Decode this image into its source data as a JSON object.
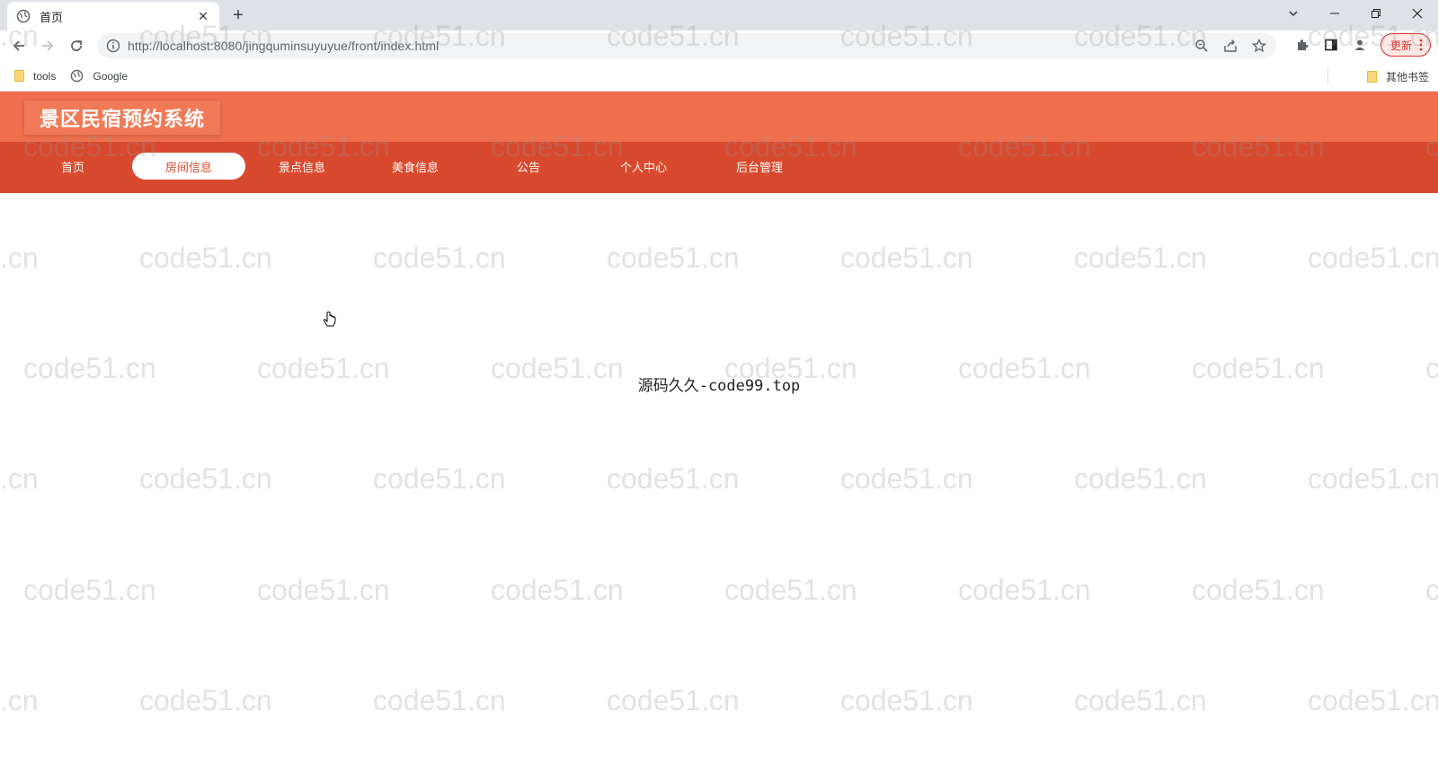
{
  "browser": {
    "tab_title": "首页",
    "url": "http://localhost:8080/jingquminsuyuyue/front/index.html",
    "update_label": "更新",
    "bookmarks": [
      {
        "label": "tools",
        "icon": "folder-icon"
      },
      {
        "label": "Google",
        "icon": "globe-icon"
      }
    ],
    "other_bookmarks": "其他书签"
  },
  "site": {
    "title": "景区民宿预约系统",
    "nav": [
      {
        "label": "首页",
        "active": false
      },
      {
        "label": "房间信息",
        "active": true
      },
      {
        "label": "景点信息",
        "active": false
      },
      {
        "label": "美食信息",
        "active": false
      },
      {
        "label": "公告",
        "active": false
      },
      {
        "label": "个人中心",
        "active": false
      },
      {
        "label": "后台管理",
        "active": false
      }
    ],
    "center_text": "源码久久-code99.top"
  },
  "watermark_text": "code51.cn",
  "colors": {
    "header": "#ef6f4d",
    "nav": "#d9492d",
    "update_accent": "#d93025"
  }
}
